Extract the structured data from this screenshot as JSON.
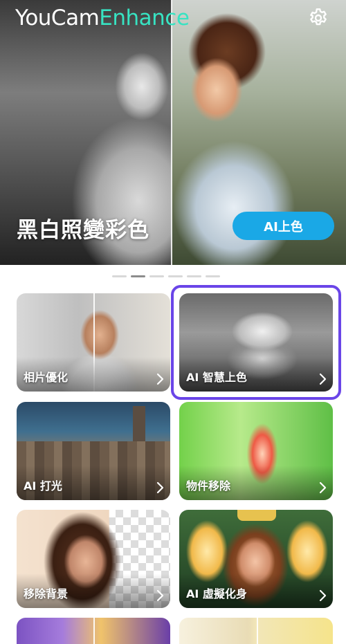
{
  "app": {
    "brand_part1": "YouCam",
    "brand_part2": "Enhance",
    "brand_accent_color": "#37e3c2",
    "settings_icon": "gear-icon"
  },
  "hero": {
    "title": "黑白照變彩色",
    "button_label": "AI上色",
    "button_color": "#1aa8e6"
  },
  "pagination": {
    "total": 6,
    "active_index": 1
  },
  "features": [
    {
      "label": "相片優化"
    },
    {
      "label": "AI 智慧上色",
      "selected": true
    },
    {
      "label": "AI 打光"
    },
    {
      "label": "物件移除"
    },
    {
      "label": "移除背景"
    },
    {
      "label": "AI 虛擬化身"
    }
  ],
  "highlight_color": "#6a45e8"
}
